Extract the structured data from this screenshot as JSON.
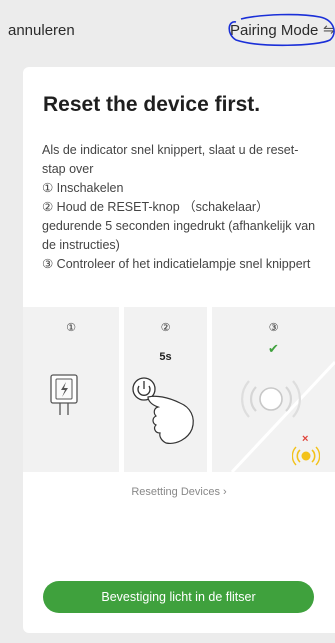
{
  "header": {
    "cancel_label": "annuleren",
    "mode_label": "Pairing Mode",
    "mode_icon": "swap-icon",
    "annotation_color": "#1a2fd8"
  },
  "card": {
    "title": "Reset the device first.",
    "instructions": [
      "Als de indicator snel knippert, slaat u de reset-stap over",
      "① Inschakelen",
      "② Houd de RESET-knop （schakelaar） gedurende 5 seconden ingedrukt (afhankelijk van de instructies)",
      "③ Controleer of het indicatielampje snel knippert"
    ],
    "steps": [
      {
        "number": "①",
        "icon": "plug-icon"
      },
      {
        "number": "②",
        "duration": "5s",
        "icon": "press-button-icon"
      },
      {
        "number": "③",
        "icon": "blinking-light-icon",
        "ok_mark": "✔",
        "bad_mark": "×"
      }
    ],
    "link_label": "Resetting Devices ›",
    "confirm_button": "Bevestiging licht in de flitser",
    "colors": {
      "accent": "#3fa13d",
      "error": "#e0433a",
      "indicator": "#f3c21a"
    }
  }
}
